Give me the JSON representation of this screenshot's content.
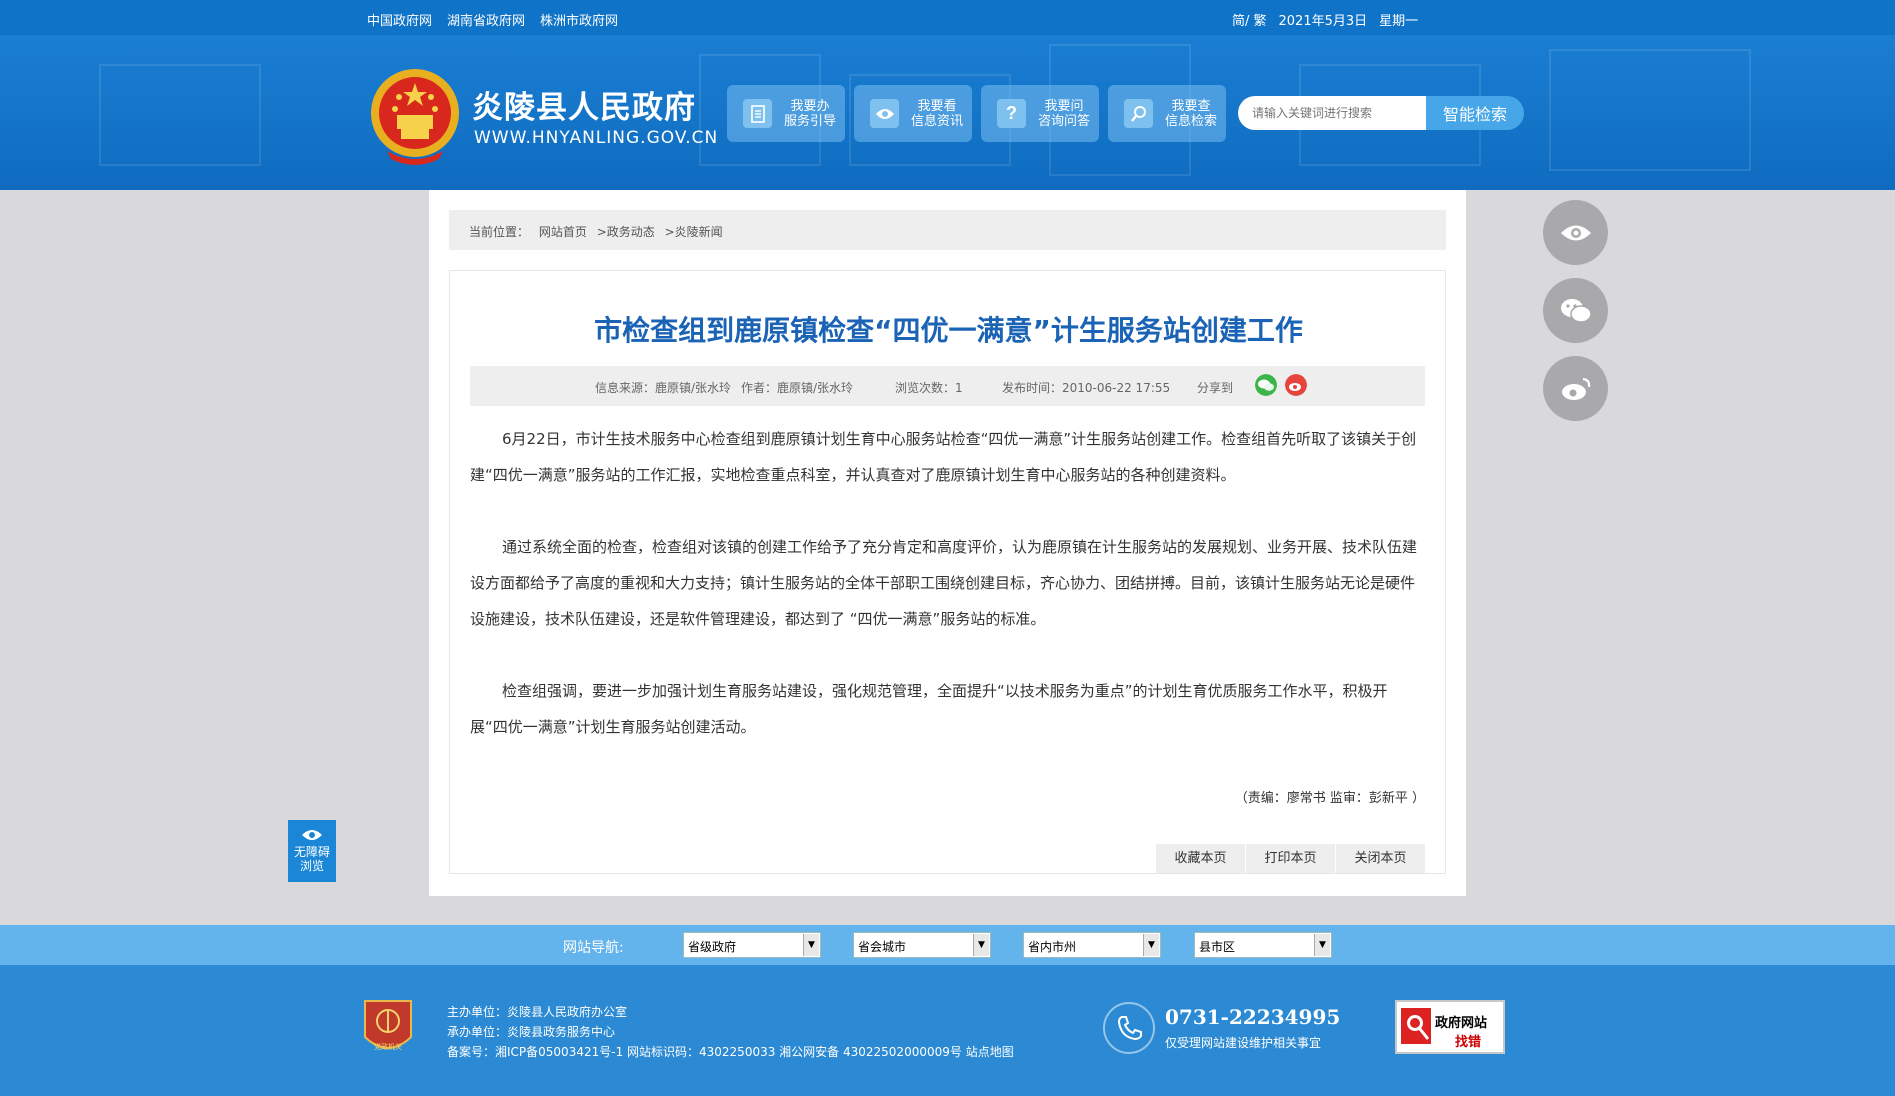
{
  "topbar": {
    "links": [
      "中国政府网",
      "湖南省政府网",
      "株洲市政府网"
    ],
    "lang": "简/ 繁",
    "date": "2021年5月3日",
    "weekday": "星期一"
  },
  "header": {
    "title": "炎陵县人民政府",
    "url": "WWW.HNYANLING.GOV.CN",
    "buttons": [
      {
        "l1": "我要办",
        "l2": "服务引导",
        "icon": "document-icon"
      },
      {
        "l1": "我要看",
        "l2": "信息资讯",
        "icon": "eye-icon"
      },
      {
        "l1": "我要问",
        "l2": "咨询问答",
        "icon": "question-icon"
      },
      {
        "l1": "我要查",
        "l2": "信息检索",
        "icon": "search-icon"
      }
    ],
    "search_placeholder": "请输入关键词进行搜索",
    "search_btn": "智能检索"
  },
  "breadcrumb": {
    "label": "当前位置：",
    "items": [
      "网站首页",
      ">政务动态",
      ">炎陵新闻"
    ]
  },
  "article": {
    "title": "市检查组到鹿原镇检查“四优一满意”计生服务站创建工作",
    "source": "信息来源：鹿原镇/张水玲",
    "author": "作者：鹿原镇/张水玲",
    "views": "浏览次数：1",
    "published": "发布时间：2010-06-22 17:55",
    "share_label": "分享到",
    "paragraphs": [
      "6月22日，市计生技术服务中心检查组到鹿原镇计划生育中心服务站检查“四优一满意”计生服务站创建工作。检查组首先听取了该镇关于创建“四优一满意”服务站的工作汇报，实地检查重点科室，并认真查对了鹿原镇计划生育中心服务站的各种创建资料。",
      "通过系统全面的检查，检查组对该镇的创建工作给予了充分肯定和高度评价，认为鹿原镇在计生服务站的发展规划、业务开展、技术队伍建设方面都给予了高度的重视和大力支持；镇计生服务站的全体干部职工围绕创建目标，齐心协力、团结拼搏。目前，该镇计生服务站无论是硬件设施建设，技术队伍建设，还是软件管理建设，都达到了 “四优一满意”服务站的标准。",
      "检查组强调，要进一步加强计划生育服务站建设，强化规范管理，全面提升“以技术服务为重点”的计划生育优质服务工作水平，积极开展“四优一满意”计划生育服务站创建活动。"
    ],
    "editor": "（责编：廖常书   监审：彭新平 ）",
    "tools": [
      "收藏本页",
      "打印本页",
      "关闭本页"
    ]
  },
  "a11y": {
    "l1": "无障碍",
    "l2": "浏览"
  },
  "nav": {
    "label": "网站导航:",
    "selects": [
      "省级政府",
      "省会城市",
      "省内市州",
      "县市区"
    ]
  },
  "footer": {
    "host": "主办单位：炎陵县人民政府办公室",
    "organizer": "承办单位：炎陵县政务服务中心",
    "icp": "备案号：湘ICP备05003421号-1  网站标识码：4302250033  湘公网安备 43022502000009号  站点地图",
    "badge_text": "党政机关",
    "phone": "0731-22234995",
    "phone_note": "仅受理网站建设维护相关事宜",
    "err_l1": "政府网站",
    "err_l2": "找错"
  },
  "colors": {
    "primary": "#0f73c8",
    "title_blue": "#1a63b5",
    "nav_band": "#63b3ec",
    "footer": "#2b8ad3"
  }
}
